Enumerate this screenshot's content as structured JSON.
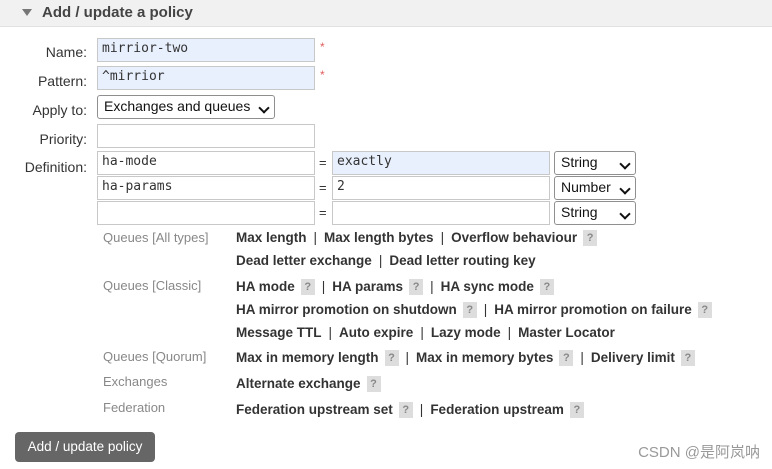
{
  "section": {
    "title": "Add / update a policy"
  },
  "form": {
    "name": {
      "label": "Name:",
      "value": "mirrior-two",
      "required": "*"
    },
    "pattern": {
      "label": "Pattern:",
      "value": "^mirrior",
      "required": "*"
    },
    "apply_to": {
      "label": "Apply to:",
      "selected": "Exchanges and queues"
    },
    "priority": {
      "label": "Priority:",
      "value": ""
    },
    "definition": {
      "label": "Definition:",
      "rows": [
        {
          "key": "ha-mode",
          "eq": "=",
          "value": "exactly",
          "type": "String"
        },
        {
          "key": "ha-params",
          "eq": "=",
          "value": "2",
          "type": "Number"
        },
        {
          "key": "",
          "eq": "=",
          "value": "",
          "type": "String"
        }
      ]
    }
  },
  "help_sections": {
    "all_types": {
      "label": "Queues [All types]",
      "line1": [
        "Max length",
        "Max length bytes",
        "Overflow behaviour"
      ],
      "line2": [
        "Dead letter exchange",
        "Dead letter routing key"
      ]
    },
    "classic": {
      "label": "Queues [Classic]",
      "line1": [
        "HA mode",
        "HA params",
        "HA sync mode"
      ],
      "line2": [
        "HA mirror promotion on shutdown",
        "HA mirror promotion on failure"
      ],
      "line3": [
        "Message TTL",
        "Auto expire",
        "Lazy mode",
        "Master Locator"
      ]
    },
    "quorum": {
      "label": "Queues [Quorum]",
      "line1": [
        "Max in memory length",
        "Max in memory bytes",
        "Delivery limit"
      ]
    },
    "exchanges": {
      "label": "Exchanges",
      "line1": [
        "Alternate exchange"
      ]
    },
    "federation": {
      "label": "Federation",
      "line1": [
        "Federation upstream set",
        "Federation upstream"
      ]
    }
  },
  "help_glyph": "?",
  "separator": "|",
  "submit_label": "Add / update policy",
  "watermark": "CSDN @是阿岚呐"
}
